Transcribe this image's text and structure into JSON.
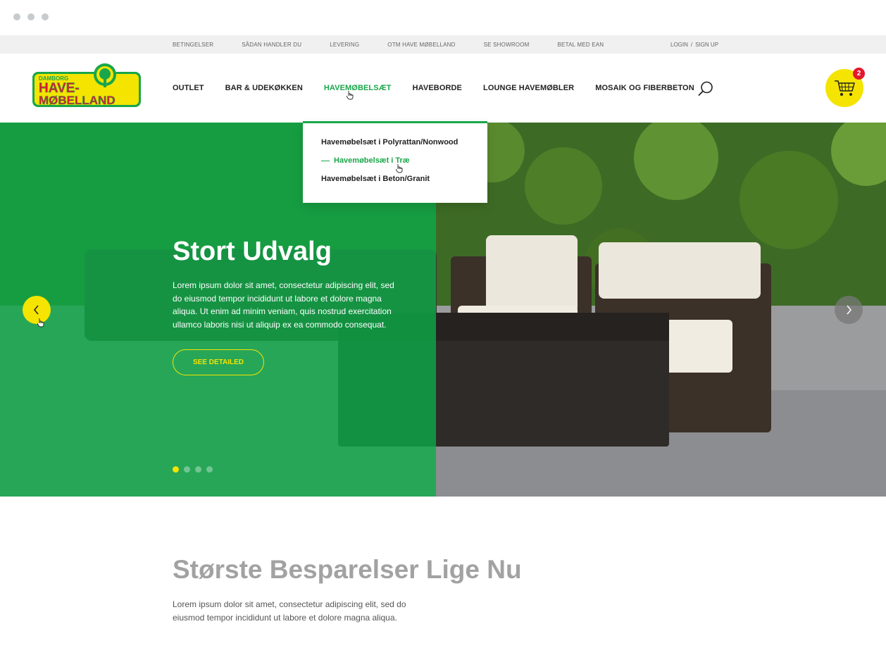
{
  "window": {
    "dots": 3
  },
  "topbar": {
    "links": [
      "BETINGELSER",
      "SÅDAN HANDLER DU",
      "LEVERING",
      "OTM HAVE MØBELLAND",
      "SE SHOWROOM",
      "BETAL MED EAN"
    ],
    "login": "LOGIN",
    "separator": "/",
    "signup": "SIGN UP"
  },
  "logo": {
    "top": "DAMBORG",
    "line1": "HAVE-",
    "line2": "MØBELLAND",
    "colors": {
      "yellow": "#f4e400",
      "red": "#e3182d",
      "green": "#1aa64a"
    }
  },
  "nav": {
    "items": [
      "OUTLET",
      "BAR & UDEKØKKEN",
      "HAVEMØBELSÆT",
      "HAVEBORDE",
      "LOUNGE HAVEMØBLER",
      "MOSAIK OG FIBERBETON"
    ],
    "active": "HAVEMØBELSÆT"
  },
  "cart": {
    "count": "2",
    "icon": "cart-icon"
  },
  "dropdown": {
    "items": [
      "Havemøbelsæt i Polyrattan/Nonwood",
      "Havemøbelsæt i Træ",
      "Havemøbelsæt i Beton/Granit"
    ],
    "active_index": 1
  },
  "hero": {
    "title": "Stort Udvalg",
    "text": "Lorem ipsum dolor sit amet, consectetur adipiscing elit, sed do eiusmod tempor incididunt ut labore et dolore magna aliqua. Ut enim ad minim veniam, quis nostrud exercitation ullamco laboris nisi ut aliquip ex ea commodo consequat.",
    "cta": "SEE DETAILED",
    "slides": 4,
    "active_slide": 0,
    "colors": {
      "overlay": "#0ea848",
      "accent": "#f4e400"
    }
  },
  "section": {
    "title": "Største Besparelser Lige Nu",
    "text": "Lorem ipsum dolor sit amet, consectetur adipiscing elit, sed do eiusmod tempor incididunt ut labore et dolore magna aliqua."
  }
}
